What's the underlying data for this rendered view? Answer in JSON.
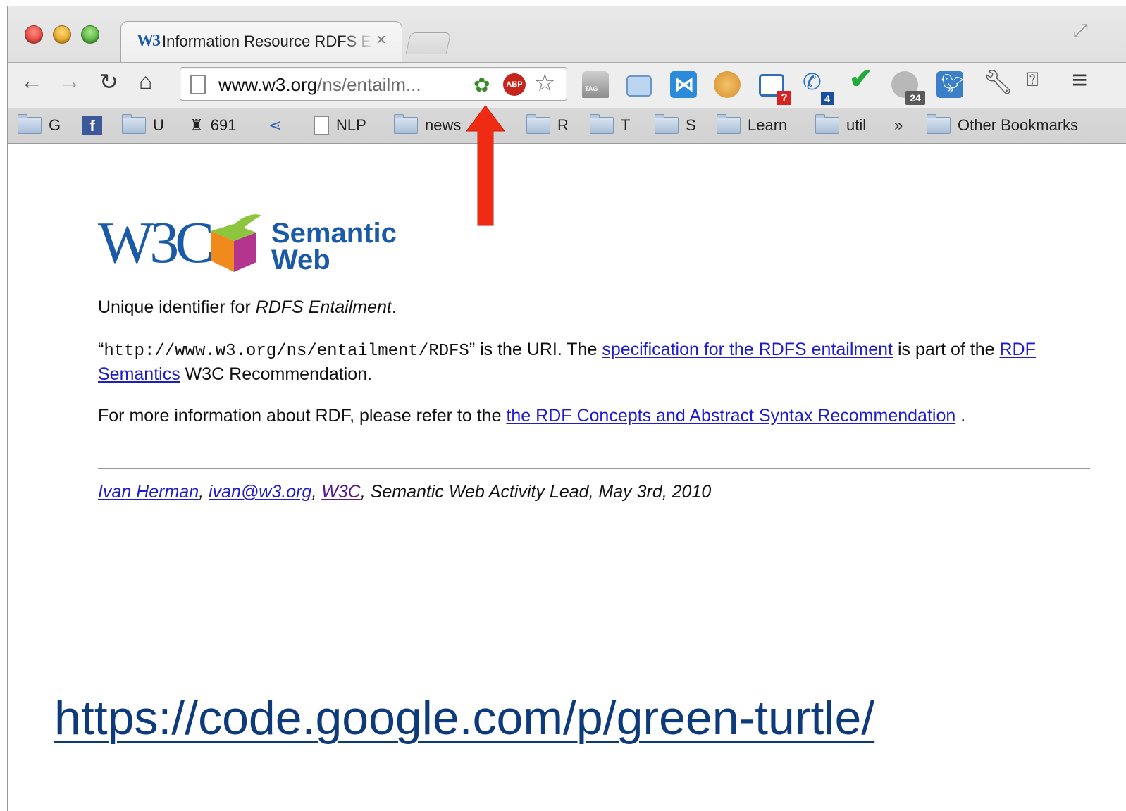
{
  "browser": {
    "tab": {
      "title": "Information Resource RDFS Entailment",
      "favicon_text": "W3",
      "close_glyph": "×"
    },
    "omnibox": {
      "host": "www.w3.org",
      "path": "/ns/entailm..."
    },
    "extensions": {
      "tag_label": "TAG",
      "screen_badge": "?",
      "phone_badge": "4",
      "gcheck_badge": "24"
    },
    "bookmarks": [
      {
        "label": "G",
        "kind": "folder"
      },
      {
        "label": "",
        "kind": "facebook"
      },
      {
        "label": "U",
        "kind": "folder"
      },
      {
        "label": "691",
        "kind": "robot"
      },
      {
        "label": "",
        "kind": "share"
      },
      {
        "label": "NLP",
        "kind": "page"
      },
      {
        "label": "news",
        "kind": "folder"
      },
      {
        "label": "R",
        "kind": "folder"
      },
      {
        "label": "T",
        "kind": "folder"
      },
      {
        "label": "S",
        "kind": "folder"
      },
      {
        "label": "Learn",
        "kind": "folder"
      },
      {
        "label": "util",
        "kind": "folder"
      },
      {
        "label": "»",
        "kind": "overflow"
      },
      {
        "label": "Other Bookmarks",
        "kind": "folder"
      }
    ]
  },
  "logo": {
    "w3c": "W3C",
    "line1": "Semantic",
    "line2": "Web"
  },
  "content": {
    "intro_prefix": "Unique identifier for ",
    "intro_em": "RDFS Entailment",
    "intro_suffix": ".",
    "uri_open": "“",
    "uri": "http://www.w3.org/ns/entailment/RDFS",
    "uri_close": "” is the URI. The ",
    "spec_link": "specification for the RDFS entailment",
    "uri_mid": " is part of the ",
    "semantics_link": "RDF Semantics",
    "uri_end": " W3C Recommendation.",
    "info_prefix": "For more information about RDF, please refer to the ",
    "concepts_link": "the RDF Concepts and Abstract Syntax Recommendation",
    "info_end": " ."
  },
  "footer": {
    "author_link": "Ivan Herman",
    "sep1": ", ",
    "email_link": "ivan@w3.org",
    "sep2": ", ",
    "w3c_link": "W3C",
    "rest": ", Semantic Web Activity Lead, May 3rd, 2010"
  },
  "caption_url": "https://code.google.com/p/green-turtle/",
  "colors": {
    "annotation_arrow": "#ef2b14",
    "link": "#1d1dcc",
    "caption": "#0d3a7a"
  },
  "icons": [
    "back-icon",
    "forward-icon",
    "reload-icon",
    "home-icon",
    "page-icon",
    "turtle-icon",
    "adblock-icon",
    "star-icon",
    "tag-icon",
    "window-icon",
    "bow-icon",
    "pig-icon",
    "screen-icon",
    "phone-icon",
    "check-icon",
    "gcheck-icon",
    "twitter-icon",
    "wrench-icon",
    "download-icon",
    "menu-icon"
  ]
}
